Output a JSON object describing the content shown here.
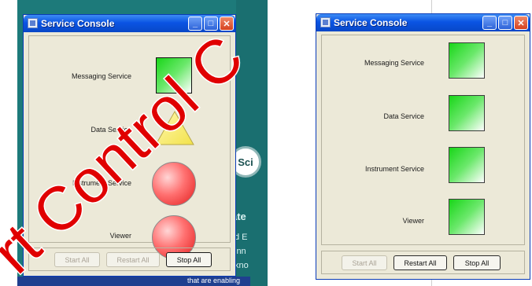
{
  "background": {
    "badge_text": "Sci",
    "side_texts": [
      "ate",
      "d E",
      "inn",
      "kno",
      "that are enabling"
    ]
  },
  "left_window": {
    "title": "Service Console",
    "services": [
      {
        "label": "Messaging Service",
        "status_shape": "green-square",
        "color": "#19d619"
      },
      {
        "label": "Data Service",
        "status_shape": "yellow-triangle",
        "color": "#f2e24a"
      },
      {
        "label": "Instrument Service",
        "status_shape": "red-circle",
        "color": "#e21d1d"
      },
      {
        "label": "Viewer",
        "status_shape": "red-circle",
        "color": "#e21d1d"
      }
    ],
    "buttons": {
      "start_all": "Start All",
      "restart_all": "Restart All",
      "stop_all": "Stop All"
    }
  },
  "right_window": {
    "title": "Service Console",
    "services": [
      {
        "label": "Messaging Service",
        "status_shape": "green-square",
        "color": "#19d619"
      },
      {
        "label": "Data Service",
        "status_shape": "green-square",
        "color": "#19d619"
      },
      {
        "label": "Instrument Service",
        "status_shape": "green-square",
        "color": "#19d619"
      },
      {
        "label": "Viewer",
        "status_shape": "green-square",
        "color": "#19d619"
      }
    ],
    "buttons": {
      "start_all": "Start All",
      "restart_all": "Restart All",
      "stop_all": "Stop All"
    }
  },
  "watermark": {
    "text": "rt Control C",
    "color": "#e00000"
  }
}
